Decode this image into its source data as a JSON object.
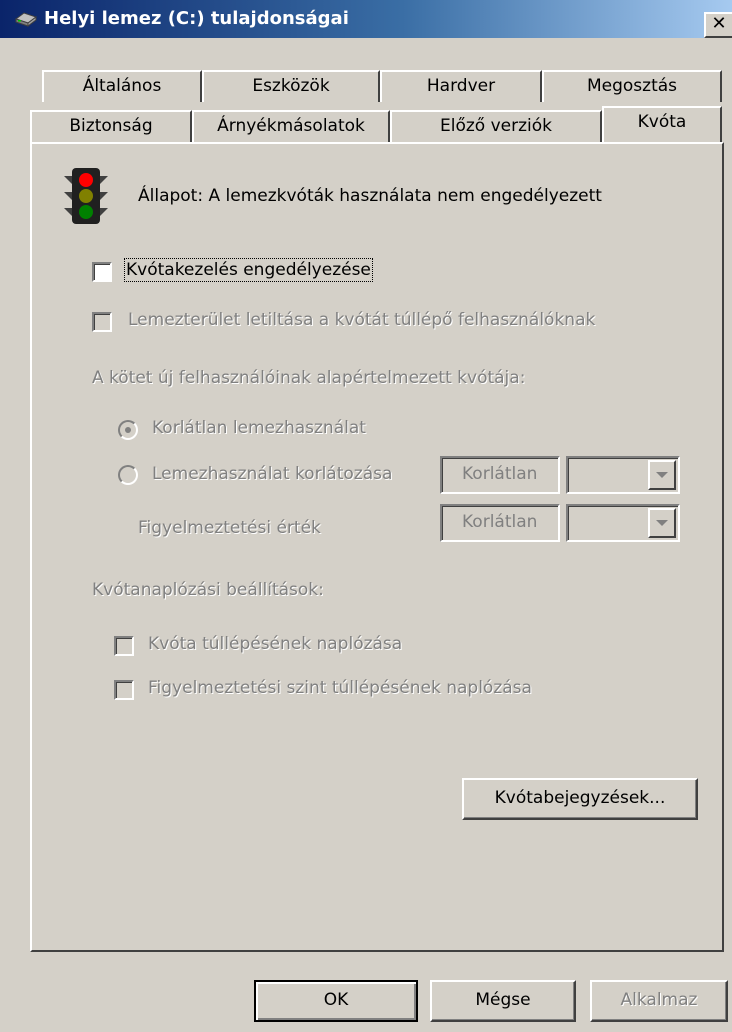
{
  "window": {
    "title": "Helyi lemez (C:) tulajdonságai",
    "close_label": "✕"
  },
  "tabs": {
    "row1": [
      "Általános",
      "Eszközök",
      "Hardver",
      "Megosztás"
    ],
    "row2": [
      "Biztonság",
      "Árnyékmásolatok",
      "Előző verziók",
      "Kvóta"
    ],
    "active": "Kvóta"
  },
  "status": {
    "icon": "traffic-light-icon",
    "text": "Állapot: A lemezkvóták használata nem engedélyezett"
  },
  "options": {
    "enable_quota": {
      "label": "Kvótakezelés engedélyezése",
      "checked": false,
      "enabled": true
    },
    "deny_space": {
      "label": "Lemezterület letiltása a kvótát túllépő felhasználóknak",
      "checked": false,
      "enabled": false
    }
  },
  "default_quota": {
    "heading": "A kötet új felhasználóinak alapértelmezett kvótája:",
    "unlimited_label": "Korlátlan lemezhasználat",
    "limit_label": "Lemezhasználat korlátozása",
    "limit_value": "Korlátlan",
    "warning_label": "Figyelmeztetési érték",
    "warning_value": "Korlátlan",
    "selected": "unlimited"
  },
  "logging": {
    "heading": "Kvótanaplózási beállítások:",
    "log_exceed_label": "Kvóta túllépésének naplózása",
    "log_warning_label": "Figyelmeztetési szint túllépésének naplózása"
  },
  "buttons": {
    "entries": "Kvótabejegyzések...",
    "ok": "OK",
    "cancel": "Mégse",
    "apply": "Alkalmaz"
  },
  "colors": {
    "titlebar_start": "#0a246a",
    "titlebar_end": "#a6caf0",
    "face": "#d4d0c8",
    "disabled_text": "#808080"
  }
}
